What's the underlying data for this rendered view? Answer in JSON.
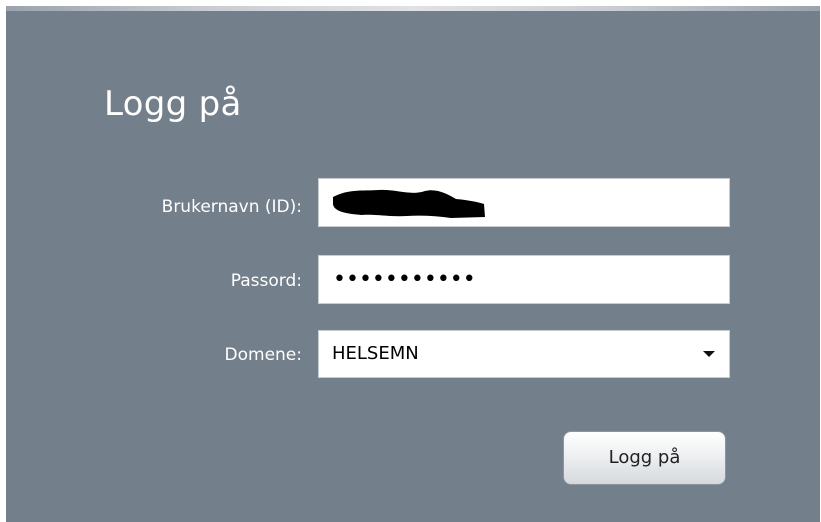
{
  "login": {
    "title": "Logg på",
    "username_label": "Brukernavn (ID):",
    "password_label": "Passord:",
    "password_masked": "•••••••••••",
    "domain_label": "Domene:",
    "domain_value": "HELSEMN",
    "submit_label": "Logg på"
  },
  "colors": {
    "panel_background": "#737f8a",
    "text": "#ffffff",
    "redaction": "#000000"
  },
  "icons": {
    "dropdown": "chevron-down-icon"
  }
}
